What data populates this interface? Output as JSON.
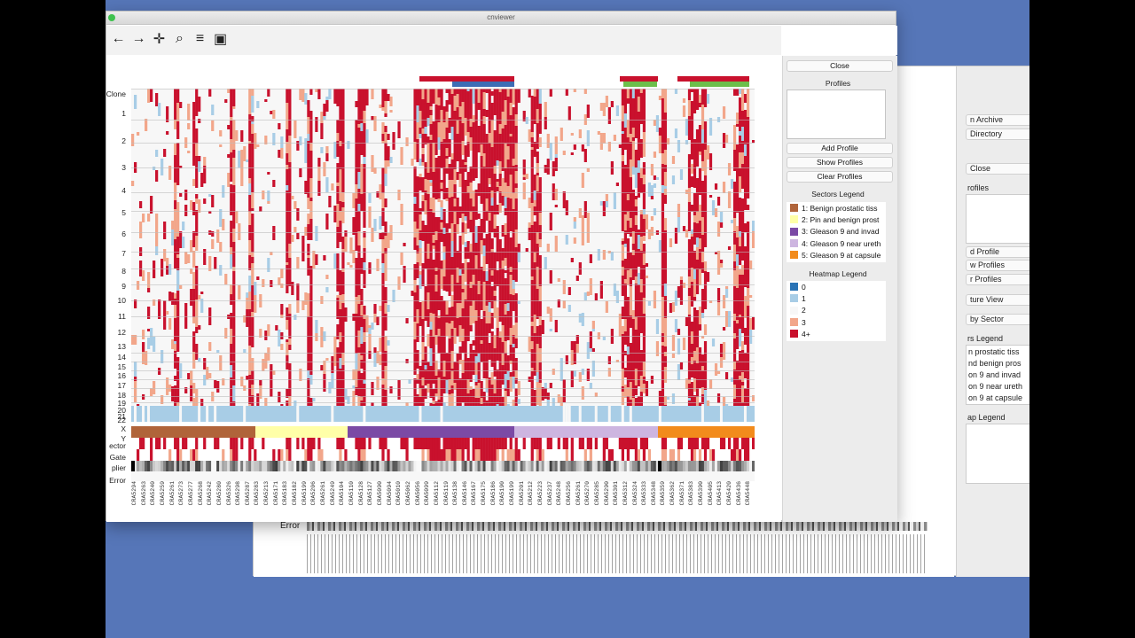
{
  "window": {
    "title": "cnviewer"
  },
  "toolbar": {
    "back": "←",
    "forward": "→",
    "pan": "✛",
    "zoom": "⌕",
    "configure": "≡",
    "save": "▣"
  },
  "plot": {
    "row_labels": [
      "Clone",
      "1",
      "2",
      "3",
      "4",
      "5",
      "6",
      "7",
      "8",
      "9",
      "10",
      "11",
      "12",
      "13",
      "14",
      "15",
      "16",
      "17",
      "18",
      "19",
      "20",
      "21",
      "22",
      "X",
      "Y",
      "ector",
      "Gate",
      "plier",
      "Error"
    ],
    "sample_labels": [
      "CRA5294",
      "CRA5263",
      "CRA5240",
      "CRA5259",
      "CRA5261",
      "CRA5273",
      "CRA5277",
      "CRA5268",
      "CRA5242",
      "CRA5280",
      "CRA5326",
      "CRA5298",
      "CRA5287",
      "CRA5283",
      "CRA5213",
      "CRA5171",
      "CRA5183",
      "CRA5182",
      "CRA5199",
      "CRA5206",
      "CRA5261",
      "CRA5249",
      "CRA5104",
      "CRA5110",
      "CRA5128",
      "CRA5127",
      "CRA5090",
      "CRA5094",
      "CRA5010",
      "CRA5062",
      "CRA5056",
      "CRA5099",
      "CRA5112",
      "CRA5119",
      "CRA5138",
      "CRA5146",
      "CRA5167",
      "CRA5175",
      "CRA5186",
      "CRA5190",
      "CRA5199",
      "CRA5201",
      "CRA5212",
      "CRA5223",
      "CRA5237",
      "CRA5248",
      "CRA5256",
      "CRA5261",
      "CRA5270",
      "CRA5285",
      "CRA5290",
      "CRA5301",
      "CRA5312",
      "CRA5324",
      "CRA5333",
      "CRA5348",
      "CRA5359",
      "CRA5362",
      "CRA5371",
      "CRA5383",
      "CRA5390",
      "CRA5405",
      "CRA5413",
      "CRA5420",
      "CRA5436",
      "CRA5448"
    ]
  },
  "panel": {
    "close": "Close",
    "profiles_heading": "Profiles",
    "add_profile": "Add Profile",
    "show_profiles": "Show Profiles",
    "clear_profiles": "Clear Profiles",
    "sectors_heading": "Sectors Legend",
    "sectors": [
      {
        "label": "1: Benign prostatic tiss",
        "color": "#b0643a"
      },
      {
        "label": "2: Pin and benign prost",
        "color": "#ffffa8"
      },
      {
        "label": "3: Gleason 9 and invad",
        "color": "#7b4aa5"
      },
      {
        "label": "4: Gleason 9 near ureth",
        "color": "#cdb5e0"
      },
      {
        "label": "5: Gleason 9 at capsule",
        "color": "#f28b1c"
      }
    ],
    "heatmap_heading": "Heatmap Legend",
    "heatmap": [
      {
        "label": "0",
        "color": "#2a74b6"
      },
      {
        "label": "1",
        "color": "#a8cde6"
      },
      {
        "label": "2",
        "color": "#f7f7f7"
      },
      {
        "label": "3",
        "color": "#f2a68a"
      },
      {
        "label": "4+",
        "color": "#c9112d"
      }
    ]
  },
  "background_window": {
    "error_label": "Error",
    "items": [
      "n Archive",
      "Directory",
      "Close",
      "rofiles",
      "d Profile",
      "w Profiles",
      "r Profiles",
      "ture View",
      "by Sector",
      "rs Legend",
      "n prostatic tiss",
      "nd benign pros",
      "on 9 and invad",
      "on 9 near ureth",
      "on 9 at capsule",
      "ap Legend"
    ]
  }
}
